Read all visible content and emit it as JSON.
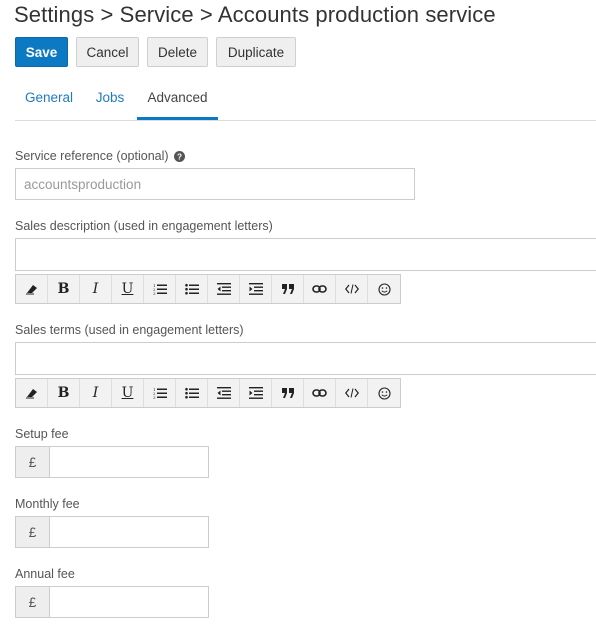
{
  "header": {
    "title": "Settings > Service > Accounts production service"
  },
  "actions": {
    "save": "Save",
    "cancel": "Cancel",
    "delete": "Delete",
    "duplicate": "Duplicate"
  },
  "tabs": [
    {
      "label": "General",
      "active": false
    },
    {
      "label": "Jobs",
      "active": false
    },
    {
      "label": "Advanced",
      "active": true
    }
  ],
  "form": {
    "service_reference": {
      "label": "Service reference (optional)",
      "value": "",
      "placeholder": "accountsproduction",
      "help_icon": "question-circle-icon"
    },
    "sales_description": {
      "label": "Sales description (used in engagement letters)",
      "value": ""
    },
    "sales_terms": {
      "label": "Sales terms (used in engagement letters)",
      "value": ""
    },
    "setup_fee": {
      "label": "Setup fee",
      "currency": "£",
      "value": ""
    },
    "monthly_fee": {
      "label": "Monthly fee",
      "currency": "£",
      "value": ""
    },
    "annual_fee": {
      "label": "Annual fee",
      "currency": "£",
      "value": ""
    }
  },
  "toolbar": {
    "buttons": [
      "eraser-icon",
      "bold-icon",
      "italic-icon",
      "underline-icon",
      "ordered-list-icon",
      "unordered-list-icon",
      "outdent-icon",
      "indent-icon",
      "quote-icon",
      "link-icon",
      "code-icon",
      "smiley-icon"
    ],
    "bold_glyph": "B",
    "italic_glyph": "I",
    "underline_glyph": "U"
  },
  "colors": {
    "primary": "#0c7ac2",
    "link": "#1f7bbf",
    "border": "#cccccc"
  }
}
